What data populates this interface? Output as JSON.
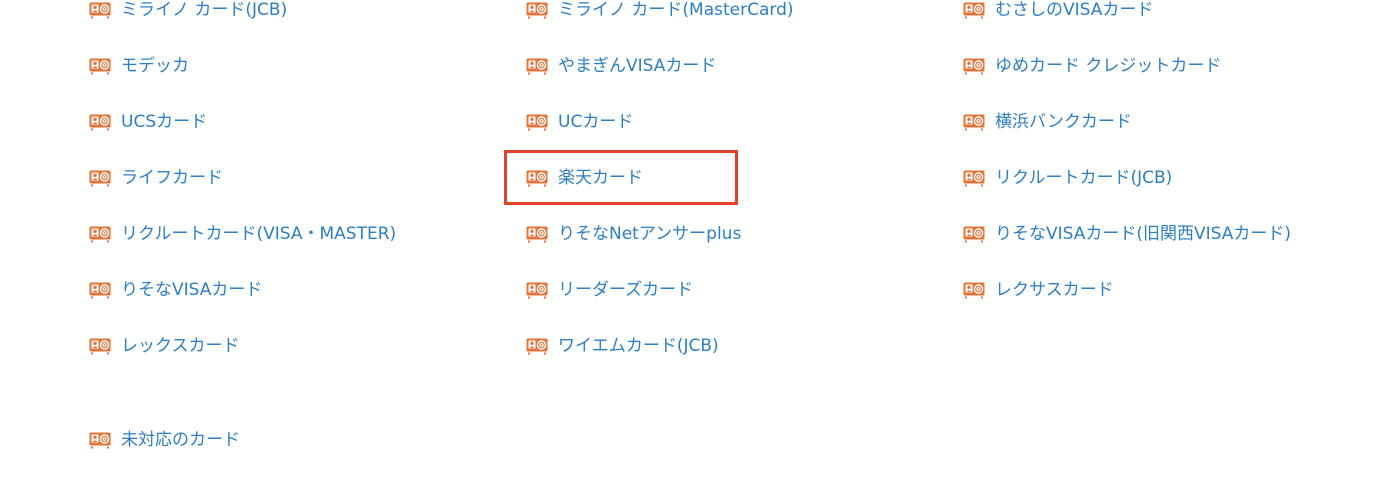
{
  "accent_color": "#2d7ec2",
  "icon_color": "#e0743a",
  "highlight_color": "#e2412a",
  "icon": "card-icon",
  "columns": [
    {
      "items": [
        {
          "label": "ミライノ カード(JCB)"
        },
        {
          "label": "モデッカ"
        },
        {
          "label": "UCSカード"
        },
        {
          "label": "ライフカード"
        },
        {
          "label": "リクルートカード(VISA・MASTER)"
        },
        {
          "label": "りそなVISAカード"
        },
        {
          "label": "レックスカード"
        }
      ]
    },
    {
      "items": [
        {
          "label": "ミライノ カード(MasterCard)"
        },
        {
          "label": "やまぎんVISAカード"
        },
        {
          "label": "UCカード"
        },
        {
          "label": "楽天カード",
          "highlighted": true
        },
        {
          "label": "りそなNetアンサーplus"
        },
        {
          "label": "リーダーズカード"
        },
        {
          "label": "ワイエムカード(JCB)"
        }
      ]
    },
    {
      "items": [
        {
          "label": "むさしのVISAカード"
        },
        {
          "label": "ゆめカード クレジットカード"
        },
        {
          "label": "横浜バンクカード"
        },
        {
          "label": "リクルートカード(JCB)"
        },
        {
          "label": "りそなVISAカード(旧関西VISAカード)"
        },
        {
          "label": "レクサスカード"
        }
      ]
    }
  ],
  "other": {
    "label": "未対応のカード"
  }
}
